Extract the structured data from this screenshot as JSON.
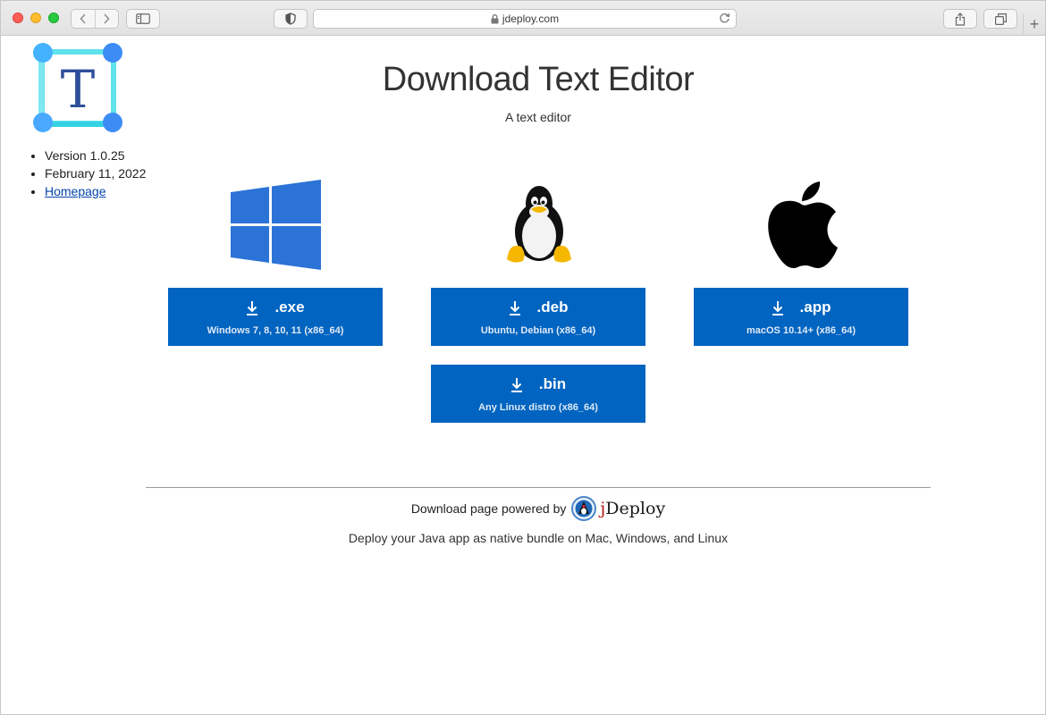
{
  "browser": {
    "url": "jdeploy.com",
    "new_tab": "+"
  },
  "sidebar": {
    "version": "Version 1.0.25",
    "date": "February 11, 2022",
    "homepage_link": "Homepage"
  },
  "header": {
    "title": "Download Text Editor",
    "subtitle": "A text editor"
  },
  "downloads": {
    "exe": {
      "ext": ".exe",
      "platform": "Windows 7, 8, 10, 11 (x86_64)"
    },
    "deb": {
      "ext": ".deb",
      "platform": "Ubuntu, Debian (x86_64)"
    },
    "app": {
      "ext": ".app",
      "platform": "macOS 10.14+ (x86_64)"
    },
    "bin": {
      "ext": ".bin",
      "platform": "Any Linux distro (x86_64)"
    }
  },
  "footer": {
    "powered_by": "Download page powered by",
    "brand_j": "j",
    "brand_rest": "Deploy",
    "tagline": "Deploy your Java app as native bundle on Mac, Windows, and Linux"
  },
  "colors": {
    "button_bg": "#0064c0",
    "windows_blue": "#2b73d6",
    "link": "#0645ad"
  },
  "icons": {
    "app": "text-editor-T-icon",
    "windows": "windows-logo",
    "linux": "tux-penguin-logo",
    "apple": "apple-logo",
    "download": "download-arrow-icon"
  }
}
